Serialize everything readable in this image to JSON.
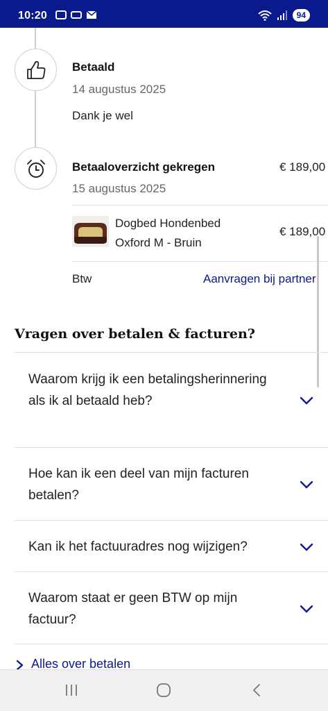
{
  "status_bar": {
    "time": "10:20",
    "battery": "94",
    "icons": [
      "screenshot-icon",
      "gallery-icon",
      "mail-icon",
      "wifi-icon",
      "signal-icon"
    ]
  },
  "timeline": {
    "paid": {
      "icon": "thumbs-up-icon",
      "title": "Betaald",
      "date": "14 augustus 2025",
      "note": "Dank je wel"
    },
    "overview": {
      "icon": "alarm-clock-icon",
      "title": "Betaaloverzicht gekregen",
      "date": "15 augustus 2025",
      "amount": "€ 189,00",
      "product": {
        "name": "Dogbed Hondenbed Oxford M - Bruin",
        "amount": "€ 189,00"
      },
      "btw_label": "Btw",
      "btw_link": "Aanvragen bij partner"
    }
  },
  "faq": {
    "heading": "Vragen over betalen & facturen?",
    "items": [
      "Waarom krijg ik een betalingsherinnering als ik al betaald heb?",
      "Hoe kan ik een deel van mijn facturen betalen?",
      "Kan ik het factuuradres nog wijzigen?",
      "Waarom staat er geen BTW op mijn factuur?"
    ],
    "more_link": "Alles over betalen"
  },
  "colors": {
    "brand": "#0a1a8c",
    "divider": "#e2e2e2",
    "muted": "#666666"
  },
  "nav": [
    "recent-apps-icon",
    "home-icon",
    "back-icon"
  ]
}
